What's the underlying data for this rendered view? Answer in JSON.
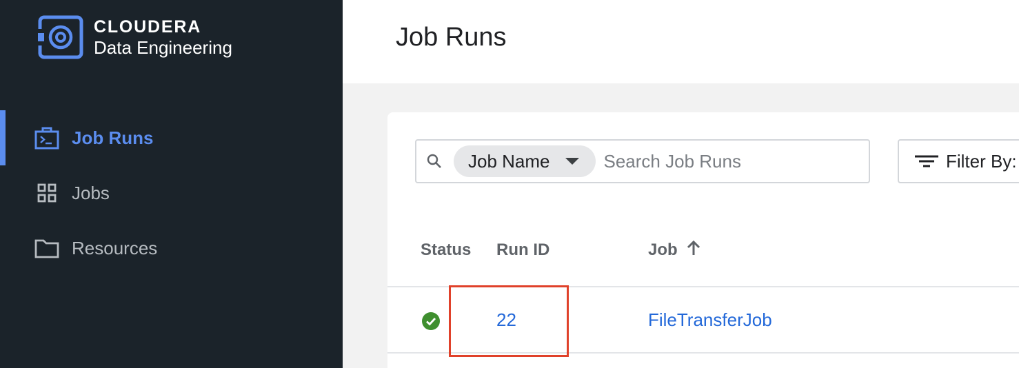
{
  "brand": {
    "company": "CLOUDERA",
    "product": "Data Engineering"
  },
  "sidebar": {
    "items": [
      {
        "label": "Job Runs",
        "icon": "terminal-briefcase-icon",
        "active": true
      },
      {
        "label": "Jobs",
        "icon": "grid-icon",
        "active": false
      },
      {
        "label": "Resources",
        "icon": "folder-icon",
        "active": false
      }
    ]
  },
  "header": {
    "title": "Job Runs"
  },
  "search": {
    "field": "Job Name",
    "placeholder": "Search Job Runs"
  },
  "filter": {
    "label": "Filter By:"
  },
  "table": {
    "columns": [
      "Status",
      "Run ID",
      "Job"
    ],
    "sort": {
      "column": "Job",
      "direction": "ascending"
    },
    "rows": [
      {
        "status": "success",
        "run_id": "22",
        "job": "FileTransferJob"
      }
    ]
  },
  "colors": {
    "sidebar_bg": "#1b232a",
    "accent": "#5b8def",
    "link": "#2469d9",
    "success": "#3f8f2f",
    "highlight": "#e0412a"
  }
}
